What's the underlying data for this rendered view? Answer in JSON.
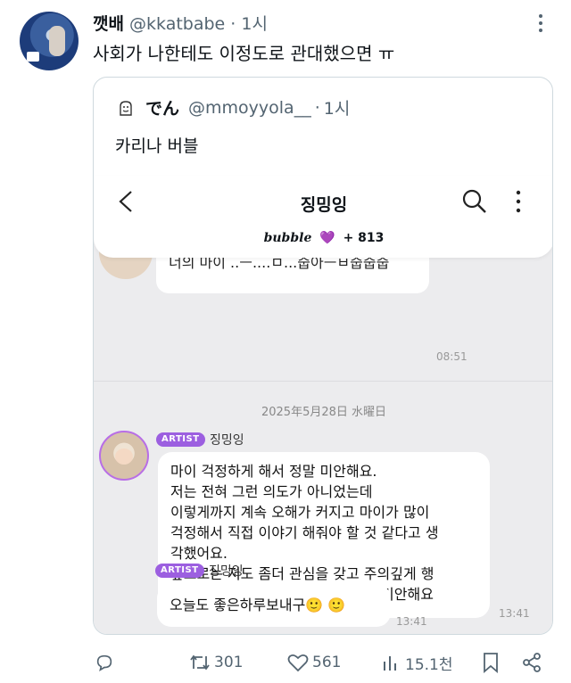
{
  "tweet": {
    "name": "깻배",
    "handle": "@kkatbabe",
    "separator": "·",
    "time": "1시",
    "text": "사회가 나한테도 이정도로 관대했으면 ㅠ"
  },
  "quote": {
    "name": "でん",
    "handle": "@mmoyyola__",
    "separator": "·",
    "time": "1시",
    "text": "카리나 버블"
  },
  "bubble_app": {
    "room_title": "징밍잉",
    "brand_logo": "bubble",
    "brand_count": "+ 813",
    "partial_message": "너의 마이 ..ㅡ....ㅁ...줍아ㅡㅂ줍줍줍",
    "partial_time": "08:51",
    "date_divider": "2025年5月28日 水曜日",
    "messages": [
      {
        "badge": "ARTIST",
        "sender": "징밍잉",
        "lines": [
          "마이 걱정하게 해서 정말 미안해요.",
          "저는 전혀 그런 의도가 아니었는데",
          "이렇게까지 계속 오해가 커지고  마이가 많이",
          "걱정해서 직접 이야기 해줘야 할 것 같다고 생",
          "각했어요.",
          "앞으로는 저도 좀더 관심을 갖고 주의깊게 행",
          "동하겠습니다 다시한번 걱정끼쳐서 미안해요"
        ],
        "time": "13:41"
      },
      {
        "badge": "ARTIST",
        "sender": "징밍잉",
        "lines": [
          "오늘도 좋은하루보내구🙂 🙂"
        ],
        "time": "13:41"
      }
    ]
  },
  "actions": {
    "retweets": "301",
    "likes": "561",
    "views": "15.1천"
  },
  "colors": {
    "accent_purple": "#9c5fe0",
    "text_secondary": "#536471",
    "chat_background": "#ececee"
  },
  "icons": [
    "more-icon",
    "back-arrow-icon",
    "search-icon",
    "kebab-icon",
    "reply-icon",
    "retweet-icon",
    "like-icon",
    "views-icon",
    "bookmark-icon",
    "share-icon"
  ]
}
